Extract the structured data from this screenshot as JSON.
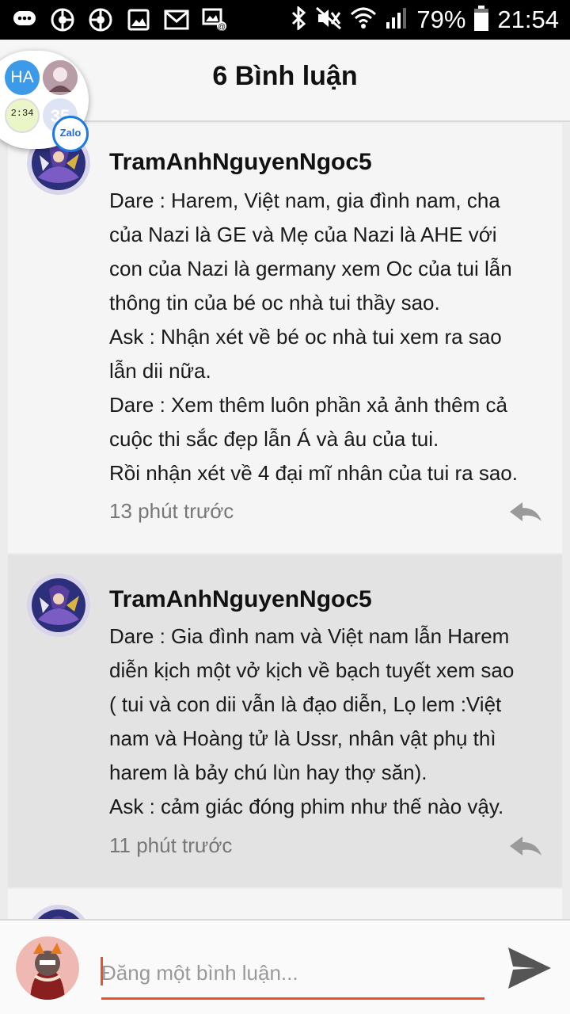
{
  "status_bar": {
    "battery": "79%",
    "time": "21:54",
    "left_icons": [
      "chat-icon",
      "disc-icon",
      "disc-icon",
      "image-icon",
      "gmail-icon",
      "gallery-icon"
    ],
    "right_icons": [
      "bluetooth-icon",
      "mute-icon",
      "wifi-icon",
      "signal-icon",
      "battery-icon"
    ]
  },
  "header": {
    "title": "6 Bình luận"
  },
  "chat_head": {
    "initials": "HA",
    "count": "35",
    "app": "Zalo",
    "clock_text": "2:34"
  },
  "comments": [
    {
      "author": "TramAnhNguyenNgoc5",
      "lines": [
        "Dare : Harem, Việt nam, gia đình nam, cha",
        "của Nazi là GE và Mẹ của Nazi là AHE với",
        "con của Nazi là germany xem Oc của tui lẫn",
        "thông tin của bé oc nhà tui thầy sao.",
        "Ask : Nhận xét về bé oc nhà tui xem ra sao",
        "lẫn dii nữa.",
        "Dare : Xem thêm luôn phần xả ảnh thêm cả",
        "cuộc thi sắc đẹp lẫn Á và âu của tui.",
        "Rồi nhận xét về 4 đại mĩ nhân của tui ra sao."
      ],
      "time": "13 phút trước"
    },
    {
      "author": "TramAnhNguyenNgoc5",
      "lines": [
        "Dare : Gia đình nam và Việt nam lẫn Harem",
        "diễn kịch một vở kịch về bạch tuyết xem sao",
        "( tui và con dii vẫn là đạo diễn, Lọ lem :Việt",
        "nam và Hoàng tử là Ussr, nhân vật phụ thì",
        "harem là bảy chú lùn hay thợ săn).",
        "Ask : cảm giác đóng phim như thế nào vậy."
      ],
      "time": "11 phút trước"
    }
  ],
  "composer": {
    "placeholder": "Đăng một bình luận..."
  },
  "colors": {
    "accent": "#e8532b",
    "header_bg": "#f6f6f6",
    "highlight_row": "#e3e3e3"
  }
}
